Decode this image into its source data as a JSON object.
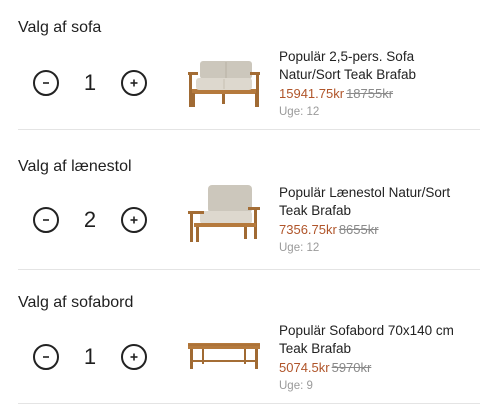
{
  "sections": [
    {
      "title": "Valg af sofa",
      "quantity": "1",
      "product": {
        "name": "Populär 2,5-pers. Sofa Natur/Sort Teak Brafab",
        "price": "15941.75kr",
        "old_price": "18755kr",
        "week": "Uge: 12",
        "image_icon": "sofa-image"
      }
    },
    {
      "title": "Valg af lænestol",
      "quantity": "2",
      "product": {
        "name": "Populär Lænestol Natur/Sort Teak Brafab",
        "price": "7356.75kr",
        "old_price": "8655kr",
        "week": "Uge: 12",
        "image_icon": "armchair-image"
      }
    },
    {
      "title": "Valg af sofabord",
      "quantity": "1",
      "product": {
        "name": "Populär Sofabord 70x140 cm Teak Brafab",
        "price": "5074.5kr",
        "old_price": "5970kr",
        "week": "Uge: 9",
        "image_icon": "coffee-table-image"
      }
    }
  ],
  "colors": {
    "price": "#b0552a",
    "old_price": "#8a8a8a",
    "week": "#9a9a9a",
    "divider": "#e4e4e4"
  },
  "icons": {
    "decrease": "minus-icon",
    "increase": "plus-icon"
  }
}
